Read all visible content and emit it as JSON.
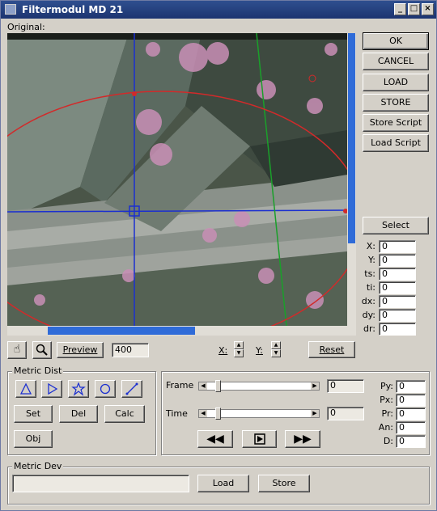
{
  "window": {
    "title": "Filtermodul MD 21"
  },
  "original_label": "Original:",
  "right_buttons": {
    "ok": "OK",
    "cancel": "CANCEL",
    "load": "LOAD",
    "store": "STORE",
    "store_script": "Store Script",
    "load_script": "Load Script",
    "select": "Select"
  },
  "coords": [
    {
      "label": "X:",
      "value": "0"
    },
    {
      "label": "Y:",
      "value": "0"
    },
    {
      "label": "ts:",
      "value": "0"
    },
    {
      "label": "ti:",
      "value": "0"
    },
    {
      "label": "dx:",
      "value": "0"
    },
    {
      "label": "dy:",
      "value": "0"
    },
    {
      "label": "dr:",
      "value": "0"
    }
  ],
  "toolbar": {
    "preview": "Preview",
    "size": "400",
    "x_label": "X:",
    "y_label": "Y:",
    "reset": "Reset"
  },
  "metric_dist": {
    "title": "Metric Dist",
    "set": "Set",
    "del": "Del",
    "calc": "Calc",
    "obj": "Obj"
  },
  "playback": {
    "frame_label": "Frame",
    "frame_value": "0",
    "time_label": "Time",
    "time_value": "0"
  },
  "params": [
    {
      "label": "Py:",
      "value": "0"
    },
    {
      "label": "Px:",
      "value": "0"
    },
    {
      "label": "Pr:",
      "value": "0"
    },
    {
      "label": "An:",
      "value": "0"
    },
    {
      "label": "D:",
      "value": "0"
    }
  ],
  "metric_dev": {
    "title": "Metric Dev",
    "field_value": "",
    "load": "Load",
    "store": "Store"
  }
}
